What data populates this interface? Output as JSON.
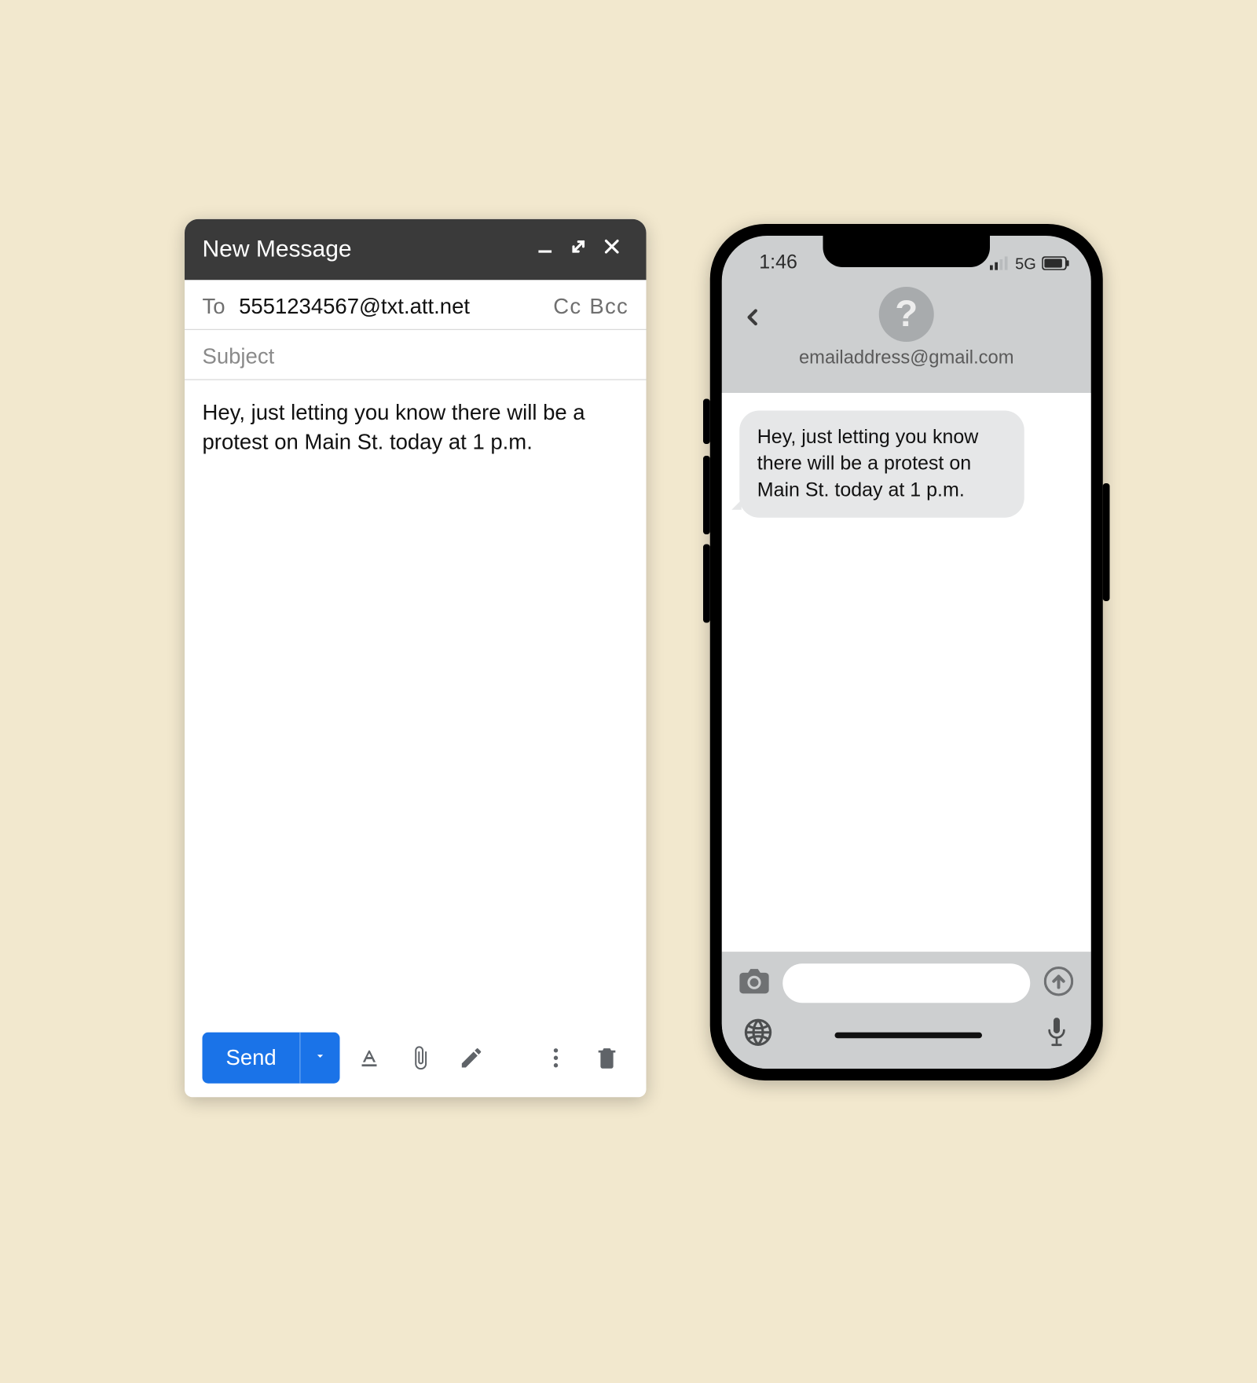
{
  "compose": {
    "title": "New Message",
    "to_label": "To",
    "to_value": "5551234567@txt.att.net",
    "cc_label": "Cc",
    "bcc_label": "Bcc",
    "subject_placeholder": "Subject",
    "body": "Hey, just letting you know there will be a protest on Main St. today at 1 p.m.",
    "send_label": "Send"
  },
  "phone": {
    "time": "1:46",
    "network": "5G",
    "contact_email": "emailaddress@gmail.com",
    "avatar_symbol": "?",
    "message": "Hey, just letting you know there will be a protest on Main St. today at 1 p.m."
  }
}
